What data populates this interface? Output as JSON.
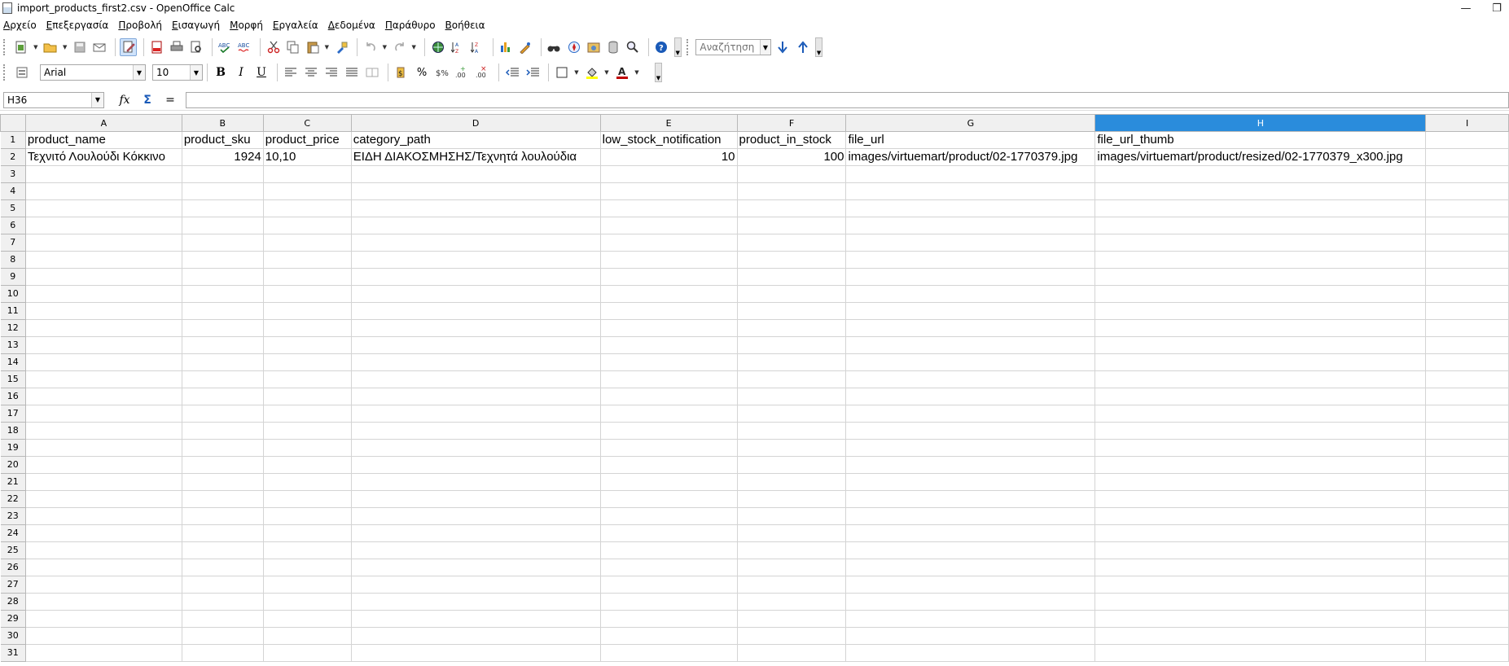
{
  "window": {
    "title": "import_products_first2.csv - OpenOffice Calc",
    "minimize_glyph": "—",
    "restore_glyph": "❐",
    "close_glyph": "✕"
  },
  "menu": [
    {
      "u": "Α",
      "rest": "ρχείο"
    },
    {
      "u": "Ε",
      "rest": "πεξεργασία"
    },
    {
      "u": "Π",
      "rest": "ροβολή"
    },
    {
      "u": "Ε",
      "rest": "ισαγωγή"
    },
    {
      "u": "Μ",
      "rest": "ορφή"
    },
    {
      "u": "Ε",
      "rest": "ργαλεία"
    },
    {
      "u": "Δ",
      "rest": "εδομένα"
    },
    {
      "u": "Π",
      "rest": "αράθυρο"
    },
    {
      "u": "Β",
      "rest": "οήθεια"
    }
  ],
  "toolbar": {
    "search_placeholder": "Αναζήτηση",
    "font_name": "Arial",
    "font_size": "10",
    "bold": "B",
    "italic": "I",
    "underline": "U",
    "percent": "%"
  },
  "formula_bar": {
    "name_box": "H36",
    "formula": "",
    "fx": "fx",
    "sum": "Σ",
    "equals": "="
  },
  "columns": [
    "A",
    "B",
    "C",
    "D",
    "E",
    "F",
    "G",
    "H",
    "I"
  ],
  "selected_column": "H",
  "rows": [
    [
      "product_name",
      "product_sku",
      "product_price",
      "category_path",
      "low_stock_notification",
      "product_in_stock",
      "file_url",
      "file_url_thumb",
      ""
    ],
    [
      "Τεχνιτό Λουλούδι Κόκκινο",
      "1924",
      "10,10",
      "ΕΙΔΗ ΔΙΑΚΟΣΜΗΣΗΣ/Τεχνητά λουλούδια",
      "10",
      "100",
      "images/virtuemart/product/02-1770379.jpg",
      "images/virtuemart/product/resized/02-1770379_x300.jpg",
      ""
    ]
  ],
  "numeric_cells": [
    [
      1,
      1
    ],
    [
      1,
      4
    ],
    [
      1,
      5
    ]
  ],
  "row_count": 31,
  "colors": {
    "selected_header": "#2a8cdc",
    "header_bg": "#f0f0f0",
    "grid_line": "#d4d4d4"
  }
}
